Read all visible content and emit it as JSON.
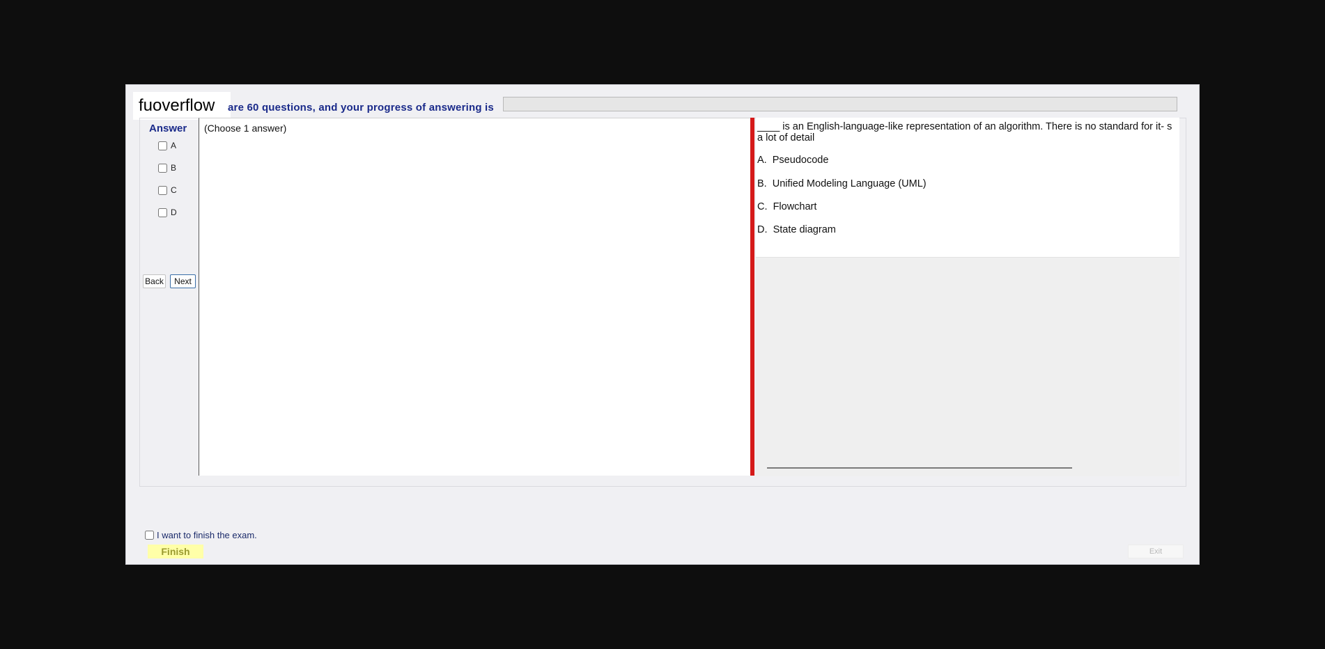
{
  "logo": {
    "text": "fuoverflow"
  },
  "header": {
    "progress_text": "are 60 questions, and your progress of answering is"
  },
  "progress": {
    "value_percent": 0
  },
  "answer": {
    "title": "Answer",
    "options": [
      {
        "label": "A",
        "checked": false
      },
      {
        "label": "B",
        "checked": false
      },
      {
        "label": "C",
        "checked": false
      },
      {
        "label": "D",
        "checked": false
      }
    ],
    "instruction": "(Choose 1 answer)"
  },
  "nav": {
    "back_label": "Back",
    "next_label": "Next"
  },
  "question": {
    "text_line1": "____ is an English-language-like representation of an algorithm. There is no standard for it- s",
    "text_line2": "a lot of detail",
    "choices": [
      {
        "letter": "A.",
        "text": "Pseudocode"
      },
      {
        "letter": "B.",
        "text": "Unified Modeling Language (UML)"
      },
      {
        "letter": "C.",
        "text": "Flowchart"
      },
      {
        "letter": "D.",
        "text": "State diagram"
      }
    ]
  },
  "footer": {
    "finish_checkbox_label": "I want to finish the exam.",
    "finish_label": "Finish",
    "exit_label": "Exit"
  },
  "colors": {
    "accent_text": "#1a2a8a",
    "splitter": "#d51a1a",
    "finish_bg": "#ffffa8"
  }
}
